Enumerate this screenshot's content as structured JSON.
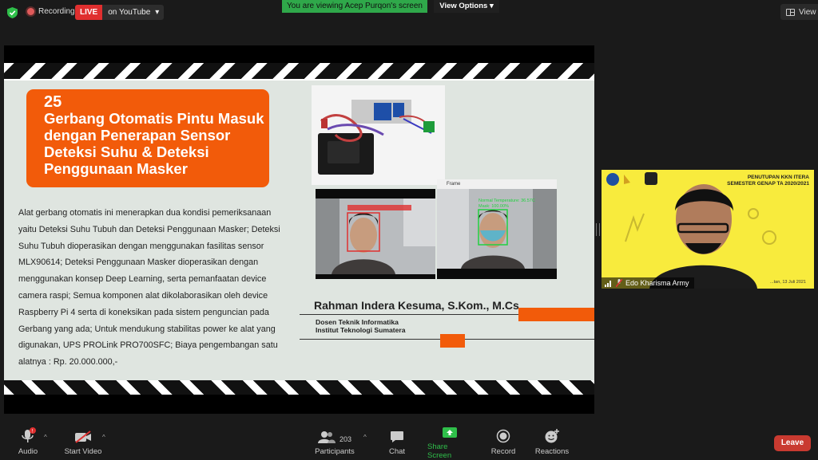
{
  "topbar": {
    "recording_label": "Recording",
    "live_badge": "LIVE",
    "live_target": "on YouTube",
    "banner_text": "You are viewing Acep Purqon's screen",
    "view_options_label": "View Options",
    "view_label": "View"
  },
  "slide": {
    "number": "25",
    "title": "Gerbang Otomatis Pintu Masuk dengan Penerapan Sensor Deteksi Suhu & Deteksi Penggunaan Masker",
    "description": "Alat gerbang otomatis ini menerapkan dua kondisi pemeriksanaan yaitu Deteksi Suhu Tubuh dan Deteksi Penggunaan Masker; Deteksi Suhu Tubuh dioperasikan dengan menggunakan fasilitas sensor MLX90614; Deteksi Penggunaan Masker dioperasikan dengan menggunakan konsep Deep Learning, serta pemanfaatan device camera raspi; Semua komponen alat dikolaborasikan oleh device Raspberry Pi 4 serta di koneksikan pada sistem penguncian pada Gerbang yang ada; Untuk mendukung stabilitas power ke alat yang digunakan, UPS PROLink PRO700SFC; Biaya pengembangan satu alatnya : Rp. 20.000.000,-",
    "frame_window_title": "Frame",
    "cam_right_label_1": "Normal Temperature: 36.57C",
    "cam_right_label_2": "Mask: 100.00%",
    "presenter_name": "Rahman Indera Kesuma, S.Kom., M.Cs",
    "presenter_position_1": "Dosen Teknik Informatika",
    "presenter_position_2": "Institut Teknologi Sumatera",
    "accent_color": "#f25b0a"
  },
  "participant": {
    "name": "Edo Kharisma Army",
    "tile_title_1": "PENUTUPAN KKN ITERA",
    "tile_title_2": "SEMESTER GENAP TA 2020/2021",
    "tile_date": "...tan, 13 Juli 2021"
  },
  "toolbar": {
    "audio": "Audio",
    "start_video": "Start Video",
    "participants": "Participants",
    "participants_count": "203",
    "chat": "Chat",
    "share_screen": "Share Screen",
    "record": "Record",
    "reactions": "Reactions",
    "leave": "Leave"
  }
}
